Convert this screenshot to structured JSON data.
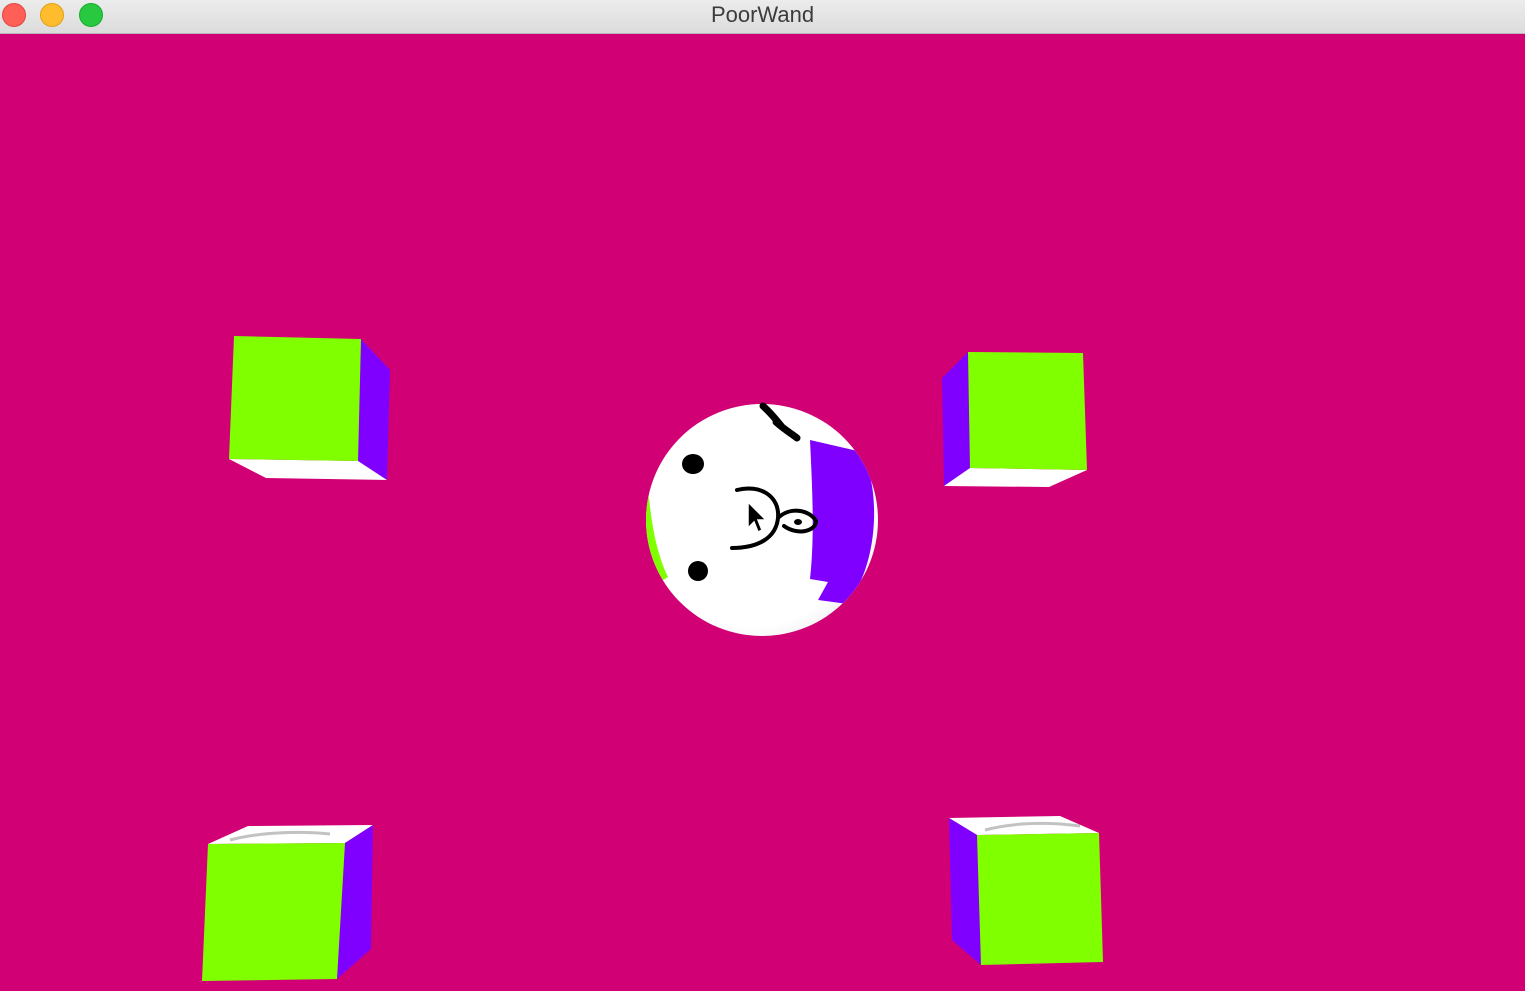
{
  "window": {
    "title": "PoorWand",
    "controls": {
      "close": "close-button",
      "minimize": "minimize-button",
      "zoom": "zoom-button"
    }
  },
  "colors": {
    "background": "#d10075",
    "cube_front": "#80ff00",
    "cube_side": "#8000ff",
    "cube_top": "#ffffff",
    "sphere": "#ffffff",
    "sphere_patch_purple": "#8000ff",
    "sphere_patch_green": "#80ff00",
    "drawing_ink": "#000000"
  },
  "scene": {
    "objects": [
      {
        "name": "cube-top-left",
        "icon": "cube-icon"
      },
      {
        "name": "cube-top-right",
        "icon": "cube-icon"
      },
      {
        "name": "cube-bottom-left",
        "icon": "cube-icon"
      },
      {
        "name": "cube-bottom-right",
        "icon": "cube-icon"
      },
      {
        "name": "face-sphere",
        "icon": "sphere-face-icon"
      }
    ],
    "cursor": "arrow-cursor-icon"
  }
}
